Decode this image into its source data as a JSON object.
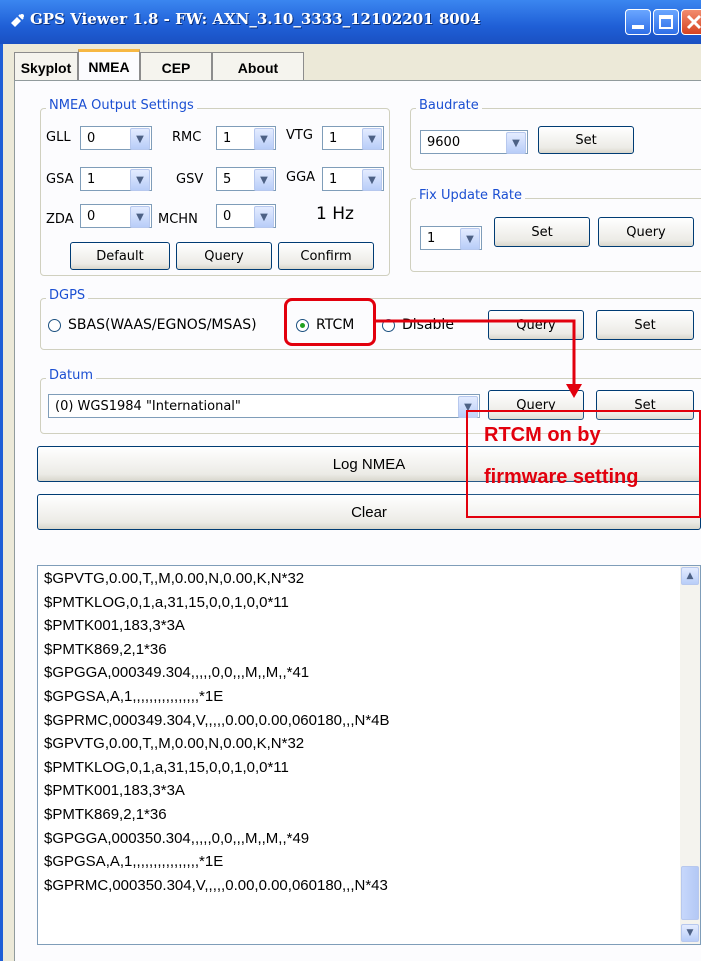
{
  "window": {
    "title": "GPS Viewer 1.8 - FW: AXN_3.10_3333_12102201 8004"
  },
  "tabs": [
    {
      "label": "Skyplot",
      "active": false
    },
    {
      "label": "NMEA",
      "active": true
    },
    {
      "label": "CEP",
      "active": false
    },
    {
      "label": "About",
      "active": false
    }
  ],
  "nmea_output": {
    "legend": "NMEA Output Settings",
    "fields": [
      {
        "label": "GLL",
        "value": "0"
      },
      {
        "label": "RMC",
        "value": "1"
      },
      {
        "label": "VTG",
        "value": "1"
      },
      {
        "label": "GSA",
        "value": "1"
      },
      {
        "label": "GSV",
        "value": "5"
      },
      {
        "label": "GGA",
        "value": "1"
      },
      {
        "label": "ZDA",
        "value": "0"
      },
      {
        "label": "MCHN",
        "value": "0"
      }
    ],
    "rate_text": "1 Hz",
    "default_label": "Default",
    "query_label": "Query",
    "confirm_label": "Confirm"
  },
  "baudrate": {
    "legend": "Baudrate",
    "value": "9600",
    "set_label": "Set"
  },
  "fix_rate": {
    "legend": "Fix Update Rate",
    "value": "1",
    "set_label": "Set",
    "query_label": "Query"
  },
  "dgps": {
    "legend": "DGPS",
    "options": [
      {
        "label": "SBAS(WAAS/EGNOS/MSAS)",
        "checked": false
      },
      {
        "label": "RTCM",
        "checked": true
      },
      {
        "label": "Disable",
        "checked": false
      }
    ],
    "query_label": "Query",
    "set_label": "Set"
  },
  "datum": {
    "legend": "Datum",
    "value": "(0) WGS1984 \"International\"",
    "query_label": "Query",
    "set_label": "Set"
  },
  "actions": {
    "log_label": "Log NMEA",
    "clear_label": "Clear"
  },
  "log_lines": [
    "$GPVTG,0.00,T,,M,0.00,N,0.00,K,N*32",
    "$PMTKLOG,0,1,a,31,15,0,0,1,0,0*11",
    "$PMTK001,183,3*3A",
    "$PMTK869,2,1*36",
    "$GPGGA,000349.304,,,,,0,0,,,M,,M,,*41",
    "$GPGSA,A,1,,,,,,,,,,,,,,,,*1E",
    "$GPRMC,000349.304,V,,,,,0.00,0.00,060180,,,N*4B",
    "$GPVTG,0.00,T,,M,0.00,N,0.00,K,N*32",
    "$PMTKLOG,0,1,a,31,15,0,0,1,0,0*11",
    "$PMTK001,183,3*3A",
    "$PMTK869,2,1*36",
    "$GPGGA,000350.304,,,,,0,0,,,M,,M,,*49",
    "$GPGSA,A,1,,,,,,,,,,,,,,,,*1E",
    "$GPRMC,000350.304,V,,,,,0.00,0.00,060180,,,N*43"
  ],
  "annotation": {
    "line1": "RTCM on by",
    "line2": "firmware setting",
    "color": "#e2000d"
  },
  "colors": {
    "titlebar": "#1f5fd6",
    "legend_text": "#1b4fd2",
    "window_bg": "#ece9d8"
  }
}
